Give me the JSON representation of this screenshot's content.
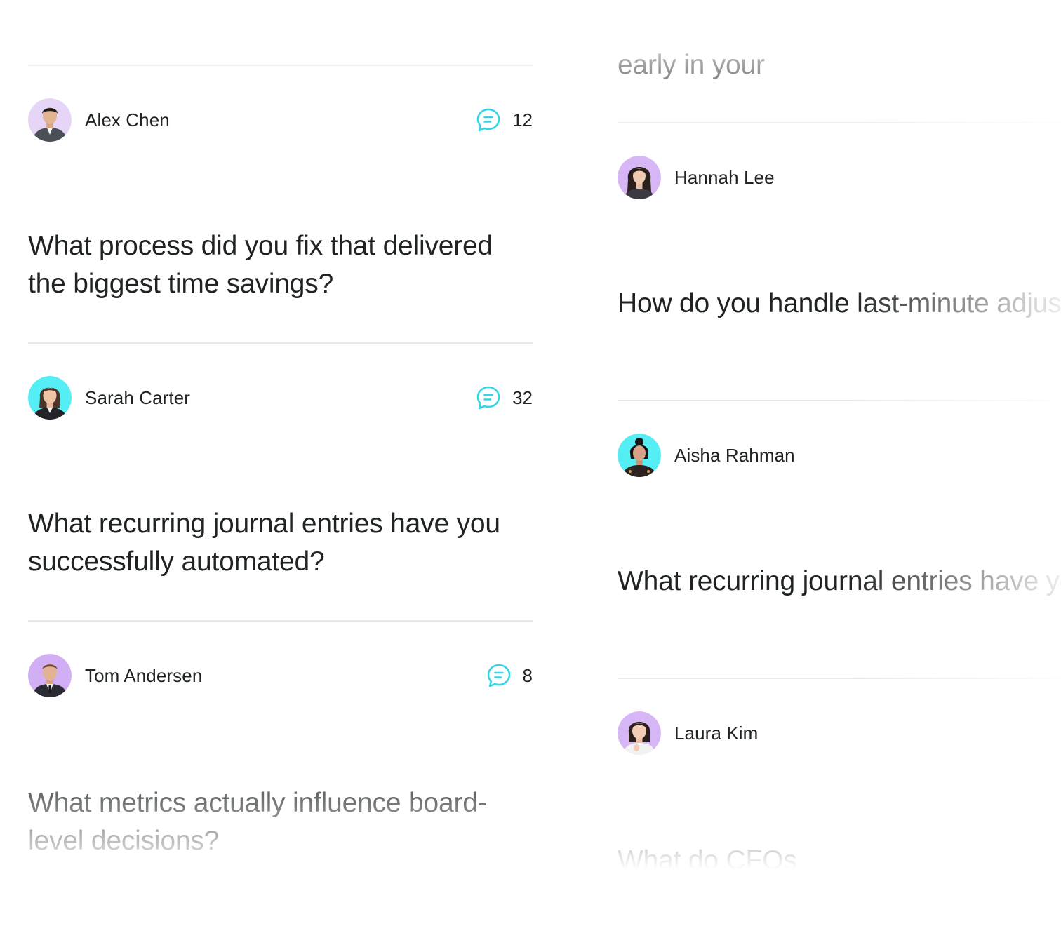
{
  "colors": {
    "text": "#1f2323",
    "accent": "#33d6e6",
    "divider": "#e3ecec",
    "avatar_lavender": "#d7b6f5",
    "avatar_cyan": "#55eef5"
  },
  "left_column": {
    "partial_question_top": "successfully automated?",
    "posts": [
      {
        "author": "Alex Chen",
        "comment_icon": "comment-bubble-icon",
        "comment_count": "12",
        "question": "What process did you fix that delivered the biggest time savings?"
      },
      {
        "author": "Sarah Carter",
        "comment_icon": "comment-bubble-icon",
        "comment_count": "32",
        "question": "What recurring journal entries have you successfully automated?"
      },
      {
        "author": "Tom Andersen",
        "comment_icon": "comment-bubble-icon",
        "comment_count": "8",
        "question": "What metrics actually influence board-level decisions?"
      }
    ]
  },
  "right_column": {
    "partial_question_top": "early in your",
    "posts": [
      {
        "author": "Hannah Lee",
        "question": "How do you handle last-minute adjustments requested by leadership?"
      },
      {
        "author": "Aisha Rahman",
        "question": "What recurring journal entries have you successfully automated?"
      },
      {
        "author": "Laura Kim",
        "question": "What do CFOs"
      }
    ]
  }
}
